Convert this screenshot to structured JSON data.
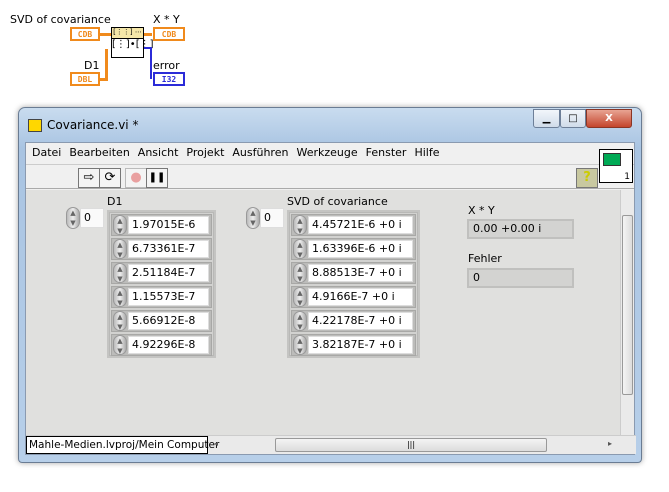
{
  "diagram": {
    "svd_label": "SVD of covariance",
    "svd_type": "CDB",
    "d1_label": "D1",
    "d1_type": "DBL",
    "xy_label": "X * Y",
    "xy_type": "CDB",
    "error_label": "error",
    "error_type": "I32"
  },
  "window": {
    "title": "Covariance.vi *",
    "minimize": "▁",
    "maximize": "□",
    "close": "X"
  },
  "menu": [
    "Datei",
    "Bearbeiten",
    "Ansicht",
    "Projekt",
    "Ausführen",
    "Werkzeuge",
    "Fenster",
    "Hilfe"
  ],
  "toolbar": {
    "run": "⇨",
    "run_continuous": "⟳",
    "abort": "●",
    "pause": "❚❚",
    "help": "?",
    "connector_number": "1"
  },
  "panel": {
    "d1": {
      "label": "D1",
      "index": "0",
      "values": [
        "1.97015E-6",
        "6.73361E-7",
        "2.51184E-7",
        "1.15573E-7",
        "5.66912E-8",
        "4.92296E-8"
      ]
    },
    "svd": {
      "label": "SVD of covariance",
      "index": "0",
      "values": [
        "4.45721E-6 +0 i",
        "1.63396E-6 +0 i",
        "8.88513E-7 +0 i",
        "4.9166E-7 +0 i",
        "4.22178E-7 +0 i",
        "3.82187E-7 +0 i"
      ]
    },
    "xy": {
      "label": "X * Y",
      "value": "0.00 +0.00 i"
    },
    "fehler": {
      "label": "Fehler",
      "value": "0"
    }
  },
  "status": {
    "project": "Mahle-Medien.lvproj/Mein Computer"
  }
}
